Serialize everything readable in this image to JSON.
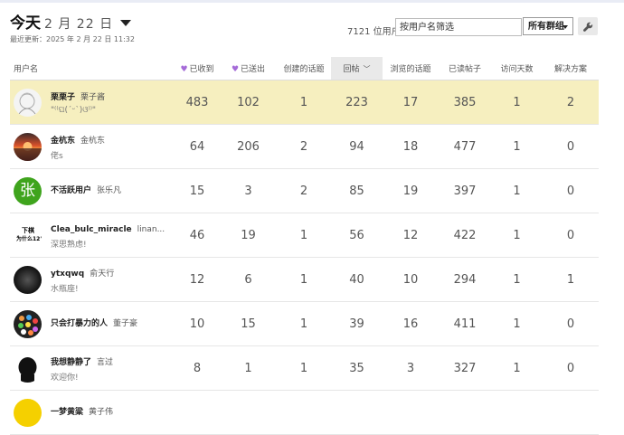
{
  "header": {
    "title": "今天",
    "date": "2 月 22 日",
    "updated": "最近更新：2025 年 2 月 22 日 11:32",
    "user_count": "7121 位用户",
    "search_placeholder": "按用户名筛选",
    "group_select": "所有群组"
  },
  "columns": {
    "username": "用户名",
    "likes_received": "已收到",
    "likes_given": "已送出",
    "topics_created": "创建的话题",
    "replies": "回帖",
    "topics_viewed": "浏览的话题",
    "posts_read": "已读帖子",
    "days_visited": "访问天数",
    "solutions": "解决方案"
  },
  "rows": [
    {
      "username": "栗栗子",
      "fullname": "栗子酱",
      "title": "\"⁽⁽ଘ(ˊᵕˋ)ଓ⁾⁾\"",
      "likes_received": "483",
      "likes_given": "102",
      "topics": "1",
      "replies": "223",
      "viewed": "17",
      "read": "385",
      "days": "1",
      "solutions": "2",
      "avatar": "sketch"
    },
    {
      "username": "金杭东",
      "fullname": "金杭东",
      "title": "佬s",
      "likes_received": "64",
      "likes_given": "206",
      "topics": "2",
      "replies": "94",
      "viewed": "18",
      "read": "477",
      "days": "1",
      "solutions": "0",
      "avatar": "sunset"
    },
    {
      "username": "不活跃用户",
      "fullname": "张乐凡",
      "title": "",
      "likes_received": "15",
      "likes_given": "3",
      "topics": "2",
      "replies": "85",
      "viewed": "19",
      "read": "397",
      "days": "1",
      "solutions": "0",
      "avatar": "letter",
      "avatar_letter": "张",
      "avatar_color": "#3fa41d"
    },
    {
      "username": "Clea_bulc_miracle",
      "fullname": "linan...",
      "title": "深思熟虑!",
      "likes_received": "46",
      "likes_given": "19",
      "topics": "1",
      "replies": "56",
      "viewed": "12",
      "read": "422",
      "days": "1",
      "solutions": "0",
      "avatar": "textimg",
      "avatar_text1": "下棋",
      "avatar_text2": "为什么12'"
    },
    {
      "username": "ytxqwq",
      "fullname": "俞天行",
      "title": "水瓶座!",
      "likes_received": "12",
      "likes_given": "6",
      "topics": "1",
      "replies": "40",
      "viewed": "10",
      "read": "294",
      "days": "1",
      "solutions": "1",
      "avatar": "dark"
    },
    {
      "username": "只会打暴力的人",
      "fullname": "董子豪",
      "title": "",
      "likes_received": "10",
      "likes_given": "15",
      "topics": "1",
      "replies": "39",
      "viewed": "16",
      "read": "411",
      "days": "1",
      "solutions": "0",
      "avatar": "dots"
    },
    {
      "username": "我想静静了",
      "fullname": "言过",
      "title": "欢迎你!",
      "likes_received": "8",
      "likes_given": "1",
      "topics": "1",
      "replies": "35",
      "viewed": "3",
      "read": "327",
      "days": "1",
      "solutions": "0",
      "avatar": "silhouette"
    },
    {
      "username": "一梦黄粱",
      "fullname": "黄子伟",
      "title": "",
      "likes_received": "",
      "likes_given": "",
      "topics": "",
      "replies": "",
      "viewed": "",
      "read": "",
      "days": "",
      "solutions": "",
      "avatar": "yellow"
    }
  ],
  "colors": {
    "highlight": "#f6efbf",
    "heart": "#a56bd8",
    "sorted_header": "#e9e9e9"
  },
  "icons": {
    "dropdown": "chevron-down-icon",
    "settings": "wrench-icon",
    "heart": "heart-icon"
  }
}
